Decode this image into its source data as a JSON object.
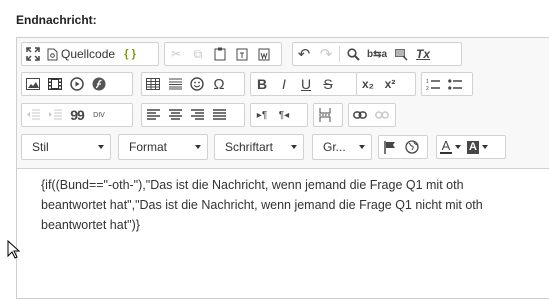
{
  "field": {
    "label": "Endnachricht:"
  },
  "toolbar": {
    "source_label": "Quellcode",
    "combos": {
      "style": "Stil",
      "format": "Format",
      "font": "Schriftart",
      "size": "Gr..."
    },
    "special_char_glyph": "Ω",
    "bold_glyph": "B",
    "italic_glyph": "I",
    "underline_glyph": "U",
    "strike_glyph": "S",
    "clear_format_glyph": "Tx",
    "subscript_glyph": "x₂",
    "superscript_glyph": "x²",
    "blockquote_glyph": "99",
    "div_glyph": "DIV",
    "text_color_glyph": "A",
    "bg_color_glyph": "A"
  },
  "content": {
    "text": "{if((Bund==\"-oth-\"),\"Das ist die Nachricht, wenn jemand die Frage Q1 mit oth beantwortet hat\",\"Das ist die Nachricht, wenn jemand die Frage Q1 nicht mit oth beantwortet hat\")}"
  },
  "colors": {
    "toolbar_bg": "#f8f8f8",
    "border": "#d1d1d1",
    "icon": "#474747",
    "icon_disabled": "#c9c9c9"
  }
}
